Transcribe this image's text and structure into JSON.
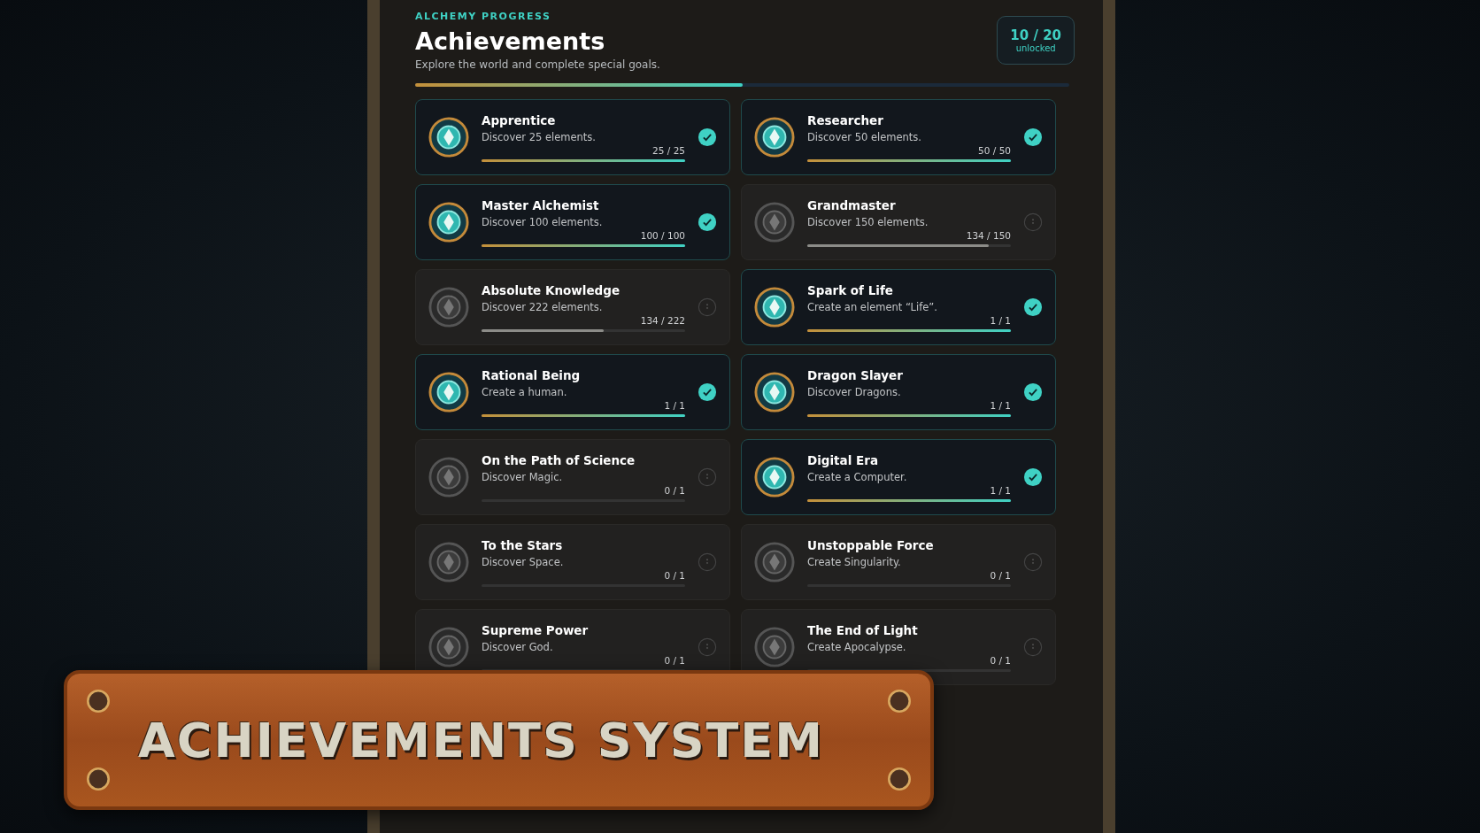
{
  "header": {
    "eyebrow": "ALCHEMY PROGRESS",
    "title": "Achievements",
    "subtitle": "Explore the world and complete special goals.",
    "counter": "10 / 20",
    "counter_label": "unlocked",
    "level": 0.5
  },
  "cards": [
    {
      "title": "Apprentice",
      "description": "Discover 25 elements.",
      "progress": "25 / 25",
      "level": 1,
      "unlocked": true
    },
    {
      "title": "Researcher",
      "description": "Discover 50 elements.",
      "progress": "50 / 50",
      "level": 1,
      "unlocked": true
    },
    {
      "title": "Master Alchemist",
      "description": "Discover 100 elements.",
      "progress": "100 / 100",
      "level": 1,
      "unlocked": true
    },
    {
      "title": "Grandmaster",
      "description": "Discover 150 elements.",
      "progress": "134 / 150",
      "level": 0.89,
      "unlocked": false
    },
    {
      "title": "Absolute Knowledge",
      "description": "Discover 222 elements.",
      "progress": "134 / 222",
      "level": 0.6,
      "unlocked": false
    },
    {
      "title": "Spark of Life",
      "description": "Create an element “Life”.",
      "progress": "1 / 1",
      "level": 1,
      "unlocked": true
    },
    {
      "title": "Rational Being",
      "description": "Create a human.",
      "progress": "1 / 1",
      "level": 1,
      "unlocked": true
    },
    {
      "title": "Dragon Slayer",
      "description": "Discover Dragons.",
      "progress": "1 / 1",
      "level": 1,
      "unlocked": true
    },
    {
      "title": "On the Path of Science",
      "description": "Discover Magic.",
      "progress": "0 / 1",
      "unlocked": false
    },
    {
      "title": "Digital Era",
      "description": "Create a Computer.",
      "progress": "1 / 1",
      "level": 1,
      "unlocked": true
    },
    {
      "title": "To the Stars",
      "description": "Discover Space.",
      "progress": "0 / 1",
      "unlocked": false
    },
    {
      "title": "Unstoppable Force",
      "description": "Create Singularity.",
      "progress": "0 / 1",
      "unlocked": false
    },
    {
      "title": "Supreme Power",
      "description": "Discover God.",
      "progress": "0 / 1",
      "unlocked": false
    },
    {
      "title": "The End of Light",
      "description": "Create Apocalypse.",
      "progress": "0 / 1",
      "unlocked": false
    }
  ],
  "banner": {
    "title": "ACHIEVEMENTS SYSTEM"
  }
}
